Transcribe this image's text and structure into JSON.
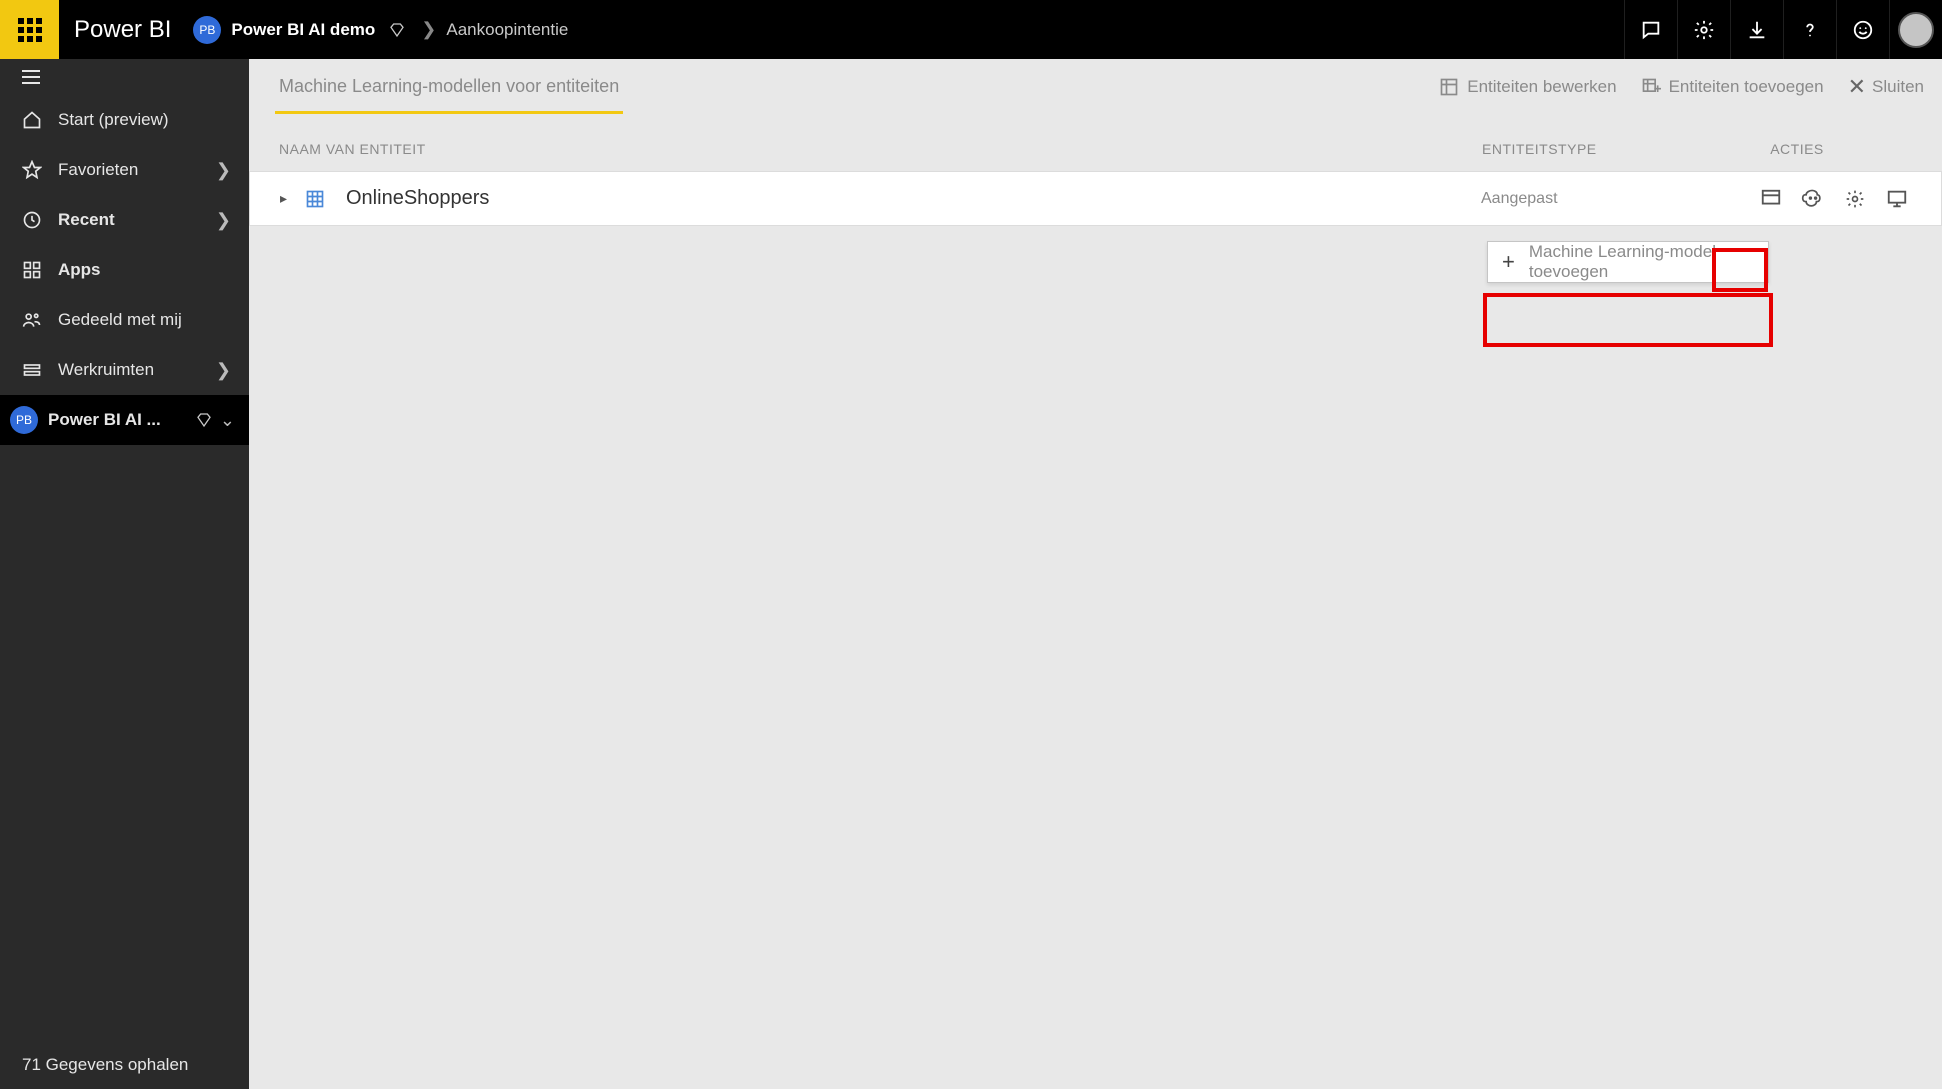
{
  "top": {
    "app_title": "Power BI",
    "workspace_chip": "PB",
    "breadcrumb_workspace": "Power BI AI demo",
    "breadcrumb_page": "Aankoopintentie"
  },
  "sidebar": {
    "items": [
      {
        "label": "Start (preview)"
      },
      {
        "label": "Favorieten"
      },
      {
        "label": "Recent"
      },
      {
        "label": "Apps"
      },
      {
        "label": "Gedeeld met mij"
      },
      {
        "label": "Werkruimten"
      }
    ],
    "active_workspace": "Power BI AI ...",
    "footer": "71 Gegevens ophalen"
  },
  "toolbar": {
    "tab_ml": "Machine Learning-modellen voor entiteiten",
    "edit_entities": "Entiteiten bewerken",
    "add_entities": "Entiteiten toevoegen",
    "close": "Sluiten"
  },
  "columns": {
    "name": "NAAM VAN ENTITEIT",
    "type": "ENTITEITSTYPE",
    "actions": "ACTIES"
  },
  "entity": {
    "name": "OnlineShoppers",
    "type": "Aangepast"
  },
  "flyout": {
    "label": "Machine Learning-model toevoegen"
  }
}
